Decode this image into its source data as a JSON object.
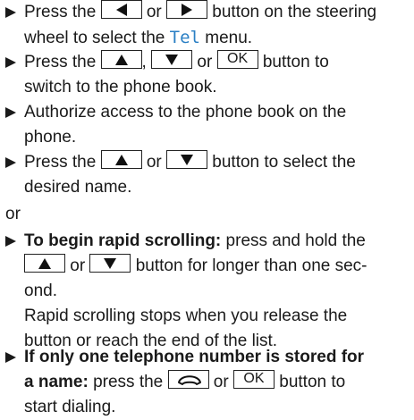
{
  "steps": [
    {
      "lines": [
        [
          "Press the ",
          "KEY:left",
          " or ",
          "KEY:right",
          " button on the steering"
        ],
        [
          "wheel to select the ",
          "DISP:Tel",
          " menu."
        ]
      ]
    },
    {
      "lines": [
        [
          "Press the ",
          "KEY:up",
          ", ",
          "KEY:down",
          " or ",
          "KEY:OK",
          " button to"
        ],
        [
          "switch to the phone book."
        ]
      ]
    },
    {
      "lines": [
        [
          "Authorize access to the phone book on the"
        ],
        [
          "phone."
        ]
      ]
    },
    {
      "lines": [
        [
          "Press the ",
          "KEY:up",
          " or ",
          "KEY:down",
          " button to select the"
        ],
        [
          "desired name."
        ]
      ]
    }
  ],
  "or_label": "or",
  "step5": {
    "bold_lead": "To begin rapid scrolling:",
    "line1_rest": " press and hold the",
    "line2_or": " or ",
    "line2_rest": " button for longer than one sec-",
    "line3": "ond.",
    "line4": "Rapid scrolling stops when you release the",
    "line5": "button or reach the end of the list."
  },
  "step6": {
    "bold_line1": "If only one telephone number is stored for",
    "bold_lead2": "a name:",
    "line2_mid": " press the ",
    "line2_or": " or ",
    "line2_rest": " button to",
    "line3": "start dialing."
  },
  "keys": {
    "ok_label": "OK"
  },
  "display_text": {
    "tel": "Tel"
  },
  "colors": {
    "display": "#2a7fc4",
    "text": "#1a1a1a"
  }
}
